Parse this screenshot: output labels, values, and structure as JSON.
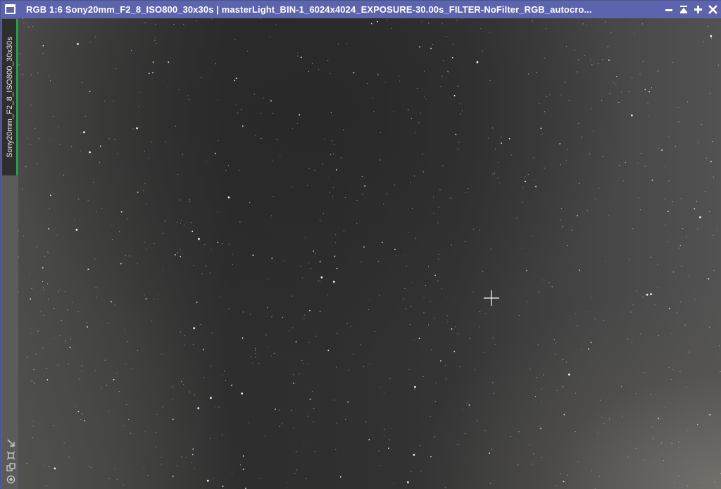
{
  "window": {
    "title": "RGB 1:6 Sony20mm_F2_8_ISO800_30x30s | masterLight_BIN-1_6024x4024_EXPOSURE-30.00s_FILTER-NoFilter_RGB_autocro...",
    "icon": "window-icon",
    "controls": [
      "minimize-icon",
      "shade-icon",
      "maximize-icon",
      "close-icon"
    ]
  },
  "sidebar": {
    "tab_label": "Sony20mm_F2_8_ISO800_30x30s",
    "accent_color": "#1fae4a",
    "tools": [
      "zoom-to-fit-icon",
      "pin-icon",
      "clone-icon",
      "view-icon"
    ]
  },
  "colors": {
    "titlebar": "#5b64ad",
    "sky": "#2e2e2e",
    "sidebar": "#5b5b5b"
  }
}
